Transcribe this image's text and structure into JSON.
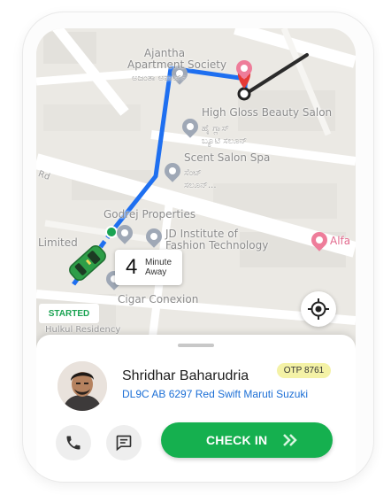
{
  "map": {
    "places": [
      {
        "name": "Ajantha Apartment Society",
        "line1": "Ajantha",
        "line2": "Apartment Society",
        "local": "ಅಜಂತಾ ಅಪಾರ್ಟ್"
      },
      {
        "name": "High Gloss Beauty Salon",
        "local_1": "ಹೈ ಗ್ಲಾಸ್",
        "local_2": "ಬ್ಯೂಟಿ ಸಲೂನ್"
      },
      {
        "name": "Scent Salon Spa",
        "local_1": "ಸೆಂಟ್",
        "local_2": "ಸಲೂನ್..."
      },
      {
        "name": "Godrej Properties",
        "display": "Godrej Properties"
      },
      {
        "name": "JD Institute of Fashion Technology",
        "line1": "JD Institute of",
        "line2": "Fashion Technology"
      },
      {
        "name": "Alfa",
        "display": "Alfa"
      },
      {
        "name": "Cigar Conexion",
        "display": "Cigar Conexion"
      },
      {
        "name": "Limited",
        "display": "Limited"
      },
      {
        "name": "Hulkul Residency",
        "display": "Hulkul Residency"
      },
      {
        "name": "Rd",
        "display": "Rd"
      }
    ],
    "eta": {
      "value": "4",
      "unit_line1": "Minute",
      "unit_line2": "Away"
    },
    "status": "STARTED",
    "colors": {
      "route": "#1e6ff0",
      "remaining_route": "#2b2b2b",
      "destination_pin": "#e53935",
      "car": "#2e9e48"
    }
  },
  "driver": {
    "name": "Shridhar Baharudria",
    "otp": "OTP 8761",
    "vehicle": "DL9C AB 6297 Red Swift Maruti Suzuki"
  },
  "actions": {
    "call_icon": "phone-icon",
    "message_icon": "message-icon",
    "checkin_label": "CHECK IN",
    "checkin_color": "#15b04f"
  }
}
